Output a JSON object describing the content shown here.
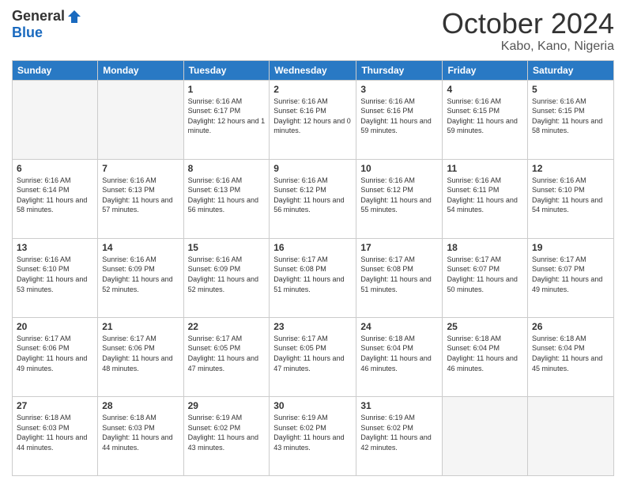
{
  "logo": {
    "general": "General",
    "blue": "Blue"
  },
  "header": {
    "month": "October 2024",
    "location": "Kabo, Kano, Nigeria"
  },
  "weekdays": [
    "Sunday",
    "Monday",
    "Tuesday",
    "Wednesday",
    "Thursday",
    "Friday",
    "Saturday"
  ],
  "weeks": [
    [
      {
        "day": "",
        "empty": true
      },
      {
        "day": "",
        "empty": true
      },
      {
        "day": "1",
        "sunrise": "6:16 AM",
        "sunset": "6:17 PM",
        "daylight": "12 hours and 1 minute."
      },
      {
        "day": "2",
        "sunrise": "6:16 AM",
        "sunset": "6:16 PM",
        "daylight": "12 hours and 0 minutes."
      },
      {
        "day": "3",
        "sunrise": "6:16 AM",
        "sunset": "6:16 PM",
        "daylight": "11 hours and 59 minutes."
      },
      {
        "day": "4",
        "sunrise": "6:16 AM",
        "sunset": "6:15 PM",
        "daylight": "11 hours and 59 minutes."
      },
      {
        "day": "5",
        "sunrise": "6:16 AM",
        "sunset": "6:15 PM",
        "daylight": "11 hours and 58 minutes."
      }
    ],
    [
      {
        "day": "6",
        "sunrise": "6:16 AM",
        "sunset": "6:14 PM",
        "daylight": "11 hours and 58 minutes."
      },
      {
        "day": "7",
        "sunrise": "6:16 AM",
        "sunset": "6:13 PM",
        "daylight": "11 hours and 57 minutes."
      },
      {
        "day": "8",
        "sunrise": "6:16 AM",
        "sunset": "6:13 PM",
        "daylight": "11 hours and 56 minutes."
      },
      {
        "day": "9",
        "sunrise": "6:16 AM",
        "sunset": "6:12 PM",
        "daylight": "11 hours and 56 minutes."
      },
      {
        "day": "10",
        "sunrise": "6:16 AM",
        "sunset": "6:12 PM",
        "daylight": "11 hours and 55 minutes."
      },
      {
        "day": "11",
        "sunrise": "6:16 AM",
        "sunset": "6:11 PM",
        "daylight": "11 hours and 54 minutes."
      },
      {
        "day": "12",
        "sunrise": "6:16 AM",
        "sunset": "6:10 PM",
        "daylight": "11 hours and 54 minutes."
      }
    ],
    [
      {
        "day": "13",
        "sunrise": "6:16 AM",
        "sunset": "6:10 PM",
        "daylight": "11 hours and 53 minutes."
      },
      {
        "day": "14",
        "sunrise": "6:16 AM",
        "sunset": "6:09 PM",
        "daylight": "11 hours and 52 minutes."
      },
      {
        "day": "15",
        "sunrise": "6:16 AM",
        "sunset": "6:09 PM",
        "daylight": "11 hours and 52 minutes."
      },
      {
        "day": "16",
        "sunrise": "6:17 AM",
        "sunset": "6:08 PM",
        "daylight": "11 hours and 51 minutes."
      },
      {
        "day": "17",
        "sunrise": "6:17 AM",
        "sunset": "6:08 PM",
        "daylight": "11 hours and 51 minutes."
      },
      {
        "day": "18",
        "sunrise": "6:17 AM",
        "sunset": "6:07 PM",
        "daylight": "11 hours and 50 minutes."
      },
      {
        "day": "19",
        "sunrise": "6:17 AM",
        "sunset": "6:07 PM",
        "daylight": "11 hours and 49 minutes."
      }
    ],
    [
      {
        "day": "20",
        "sunrise": "6:17 AM",
        "sunset": "6:06 PM",
        "daylight": "11 hours and 49 minutes."
      },
      {
        "day": "21",
        "sunrise": "6:17 AM",
        "sunset": "6:06 PM",
        "daylight": "11 hours and 48 minutes."
      },
      {
        "day": "22",
        "sunrise": "6:17 AM",
        "sunset": "6:05 PM",
        "daylight": "11 hours and 47 minutes."
      },
      {
        "day": "23",
        "sunrise": "6:17 AM",
        "sunset": "6:05 PM",
        "daylight": "11 hours and 47 minutes."
      },
      {
        "day": "24",
        "sunrise": "6:18 AM",
        "sunset": "6:04 PM",
        "daylight": "11 hours and 46 minutes."
      },
      {
        "day": "25",
        "sunrise": "6:18 AM",
        "sunset": "6:04 PM",
        "daylight": "11 hours and 46 minutes."
      },
      {
        "day": "26",
        "sunrise": "6:18 AM",
        "sunset": "6:04 PM",
        "daylight": "11 hours and 45 minutes."
      }
    ],
    [
      {
        "day": "27",
        "sunrise": "6:18 AM",
        "sunset": "6:03 PM",
        "daylight": "11 hours and 44 minutes."
      },
      {
        "day": "28",
        "sunrise": "6:18 AM",
        "sunset": "6:03 PM",
        "daylight": "11 hours and 44 minutes."
      },
      {
        "day": "29",
        "sunrise": "6:19 AM",
        "sunset": "6:02 PM",
        "daylight": "11 hours and 43 minutes."
      },
      {
        "day": "30",
        "sunrise": "6:19 AM",
        "sunset": "6:02 PM",
        "daylight": "11 hours and 43 minutes."
      },
      {
        "day": "31",
        "sunrise": "6:19 AM",
        "sunset": "6:02 PM",
        "daylight": "11 hours and 42 minutes."
      },
      {
        "day": "",
        "empty": true
      },
      {
        "day": "",
        "empty": true
      }
    ]
  ],
  "labels": {
    "sunrise": "Sunrise:",
    "sunset": "Sunset:",
    "daylight": "Daylight:"
  }
}
